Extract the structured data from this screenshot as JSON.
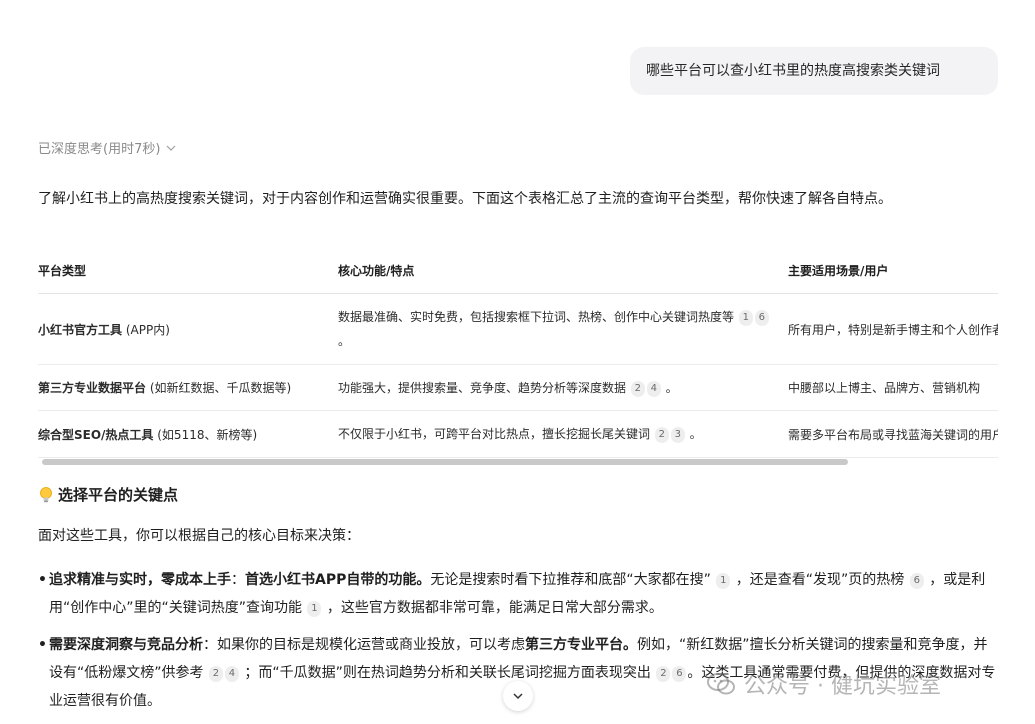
{
  "user_message": "哪些平台可以查小红书里的热度高搜索类关键词",
  "thinking_status": "已深度思考(用时7秒)",
  "intro": "了解小红书上的高热度搜索关键词，对于内容创作和运营确实很重要。下面这个表格汇总了主流的查询平台类型，帮你快速了解各自特点。",
  "table": {
    "headers": [
      "平台类型",
      "核心功能/特点",
      "主要适用场景/用户"
    ],
    "rows": [
      {
        "type_bold": "小红书官方工具",
        "type_note": " (APP内)",
        "feature": "数据最准确、实时免费，包括搜索框下拉词、热榜、创作中心关键词热度等",
        "citations": [
          "1",
          "6"
        ],
        "end": "。",
        "scene": "所有用户，特别是新手博主和个人创作者"
      },
      {
        "type_bold": "第三方专业数据平台",
        "type_note": " (如新红数据、千瓜数据等)",
        "feature": "功能强大，提供搜索量、竞争度、趋势分析等深度数据",
        "citations": [
          "2",
          "4"
        ],
        "end": "。",
        "scene": "中腰部以上博主、品牌方、营销机构"
      },
      {
        "type_bold": "综合型SEO/热点工具",
        "type_note": " (如5118、新榜等)",
        "feature": "不仅限于小红书，可跨平台对比热点，擅长挖掘长尾关键词",
        "citations": [
          "2",
          "3"
        ],
        "end": "。",
        "scene": "需要多平台布局或寻找蓝海关键词的用户"
      }
    ]
  },
  "section_title": "选择平台的关键点",
  "section_intro": "面对这些工具，你可以根据自己的核心目标来决策：",
  "bullets": [
    {
      "label": "追求精准与实时，零成本上手",
      "colon": "：",
      "strong": "首选小红书APP自带的功能。",
      "t1": "无论是搜索时看下拉推荐和底部“大家都在搜”",
      "c1": "1",
      "t2": "，还是查看“发现”页的热榜",
      "c2": "6",
      "t3": "，或是利用“创作中心”里的“关键词热度”查询功能",
      "c3": "1",
      "t4": "，这些官方数据都非常可靠，能满足日常大部分需求。"
    },
    {
      "label": "需要深度洞察与竞品分析",
      "colon": "：",
      "t1": "如果你的目标是规模化运营或商业投放，可以考虑",
      "strong": "第三方专业平台。",
      "t2": "例如，“新红数据”擅长分析关键词的搜索量和竞争度，并设有“低粉爆文榜”供参考",
      "c1": "2",
      "c2": "4",
      "t3": "；而“千瓜数据”则在热词趋势分析和关联长尾词挖掘方面表现突出",
      "c3": "2",
      "c4": "6",
      "t4": "。这类工具通常需要付费，但提供的深度数据对专业运营很有价值。"
    }
  ],
  "watermark": "公众号 · 健坑实验室"
}
